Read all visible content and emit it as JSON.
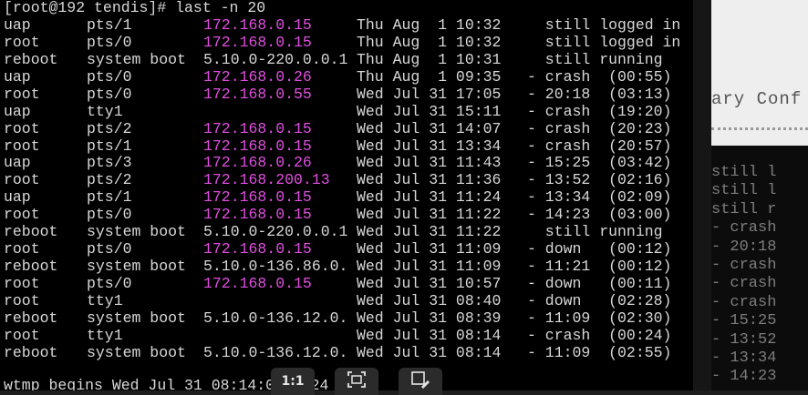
{
  "prompt": "[root@192 tendis]# last -n 20",
  "rows": [
    {
      "user": "uap",
      "tty": "pts/1",
      "host": "172.168.0.15",
      "host_is_ip": true,
      "date": "Thu Aug  1 10:32",
      "status": "  still logged in"
    },
    {
      "user": "root",
      "tty": "pts/0",
      "host": "172.168.0.15",
      "host_is_ip": true,
      "date": "Thu Aug  1 10:32",
      "status": "  still logged in"
    },
    {
      "user": "reboot",
      "tty": "system boot",
      "host": "5.10.0-220.0.0.1",
      "host_is_ip": false,
      "date": "Thu Aug  1 10:31",
      "status": "  still running"
    },
    {
      "user": "uap",
      "tty": "pts/0",
      "host": "172.168.0.26",
      "host_is_ip": true,
      "date": "Thu Aug  1 09:35",
      "status": "- crash  (00:55)"
    },
    {
      "user": "root",
      "tty": "pts/0",
      "host": "172.168.0.55",
      "host_is_ip": true,
      "date": "Wed Jul 31 17:05",
      "status": "- 20:18  (03:13)"
    },
    {
      "user": "uap",
      "tty": "tty1",
      "host": "",
      "host_is_ip": false,
      "date": "Wed Jul 31 15:11",
      "status": "- crash  (19:20)"
    },
    {
      "user": "root",
      "tty": "pts/2",
      "host": "172.168.0.15",
      "host_is_ip": true,
      "date": "Wed Jul 31 14:07",
      "status": "- crash  (20:23)"
    },
    {
      "user": "root",
      "tty": "pts/1",
      "host": "172.168.0.15",
      "host_is_ip": true,
      "date": "Wed Jul 31 13:34",
      "status": "- crash  (20:57)"
    },
    {
      "user": "uap",
      "tty": "pts/3",
      "host": "172.168.0.26",
      "host_is_ip": true,
      "date": "Wed Jul 31 11:43",
      "status": "- 15:25  (03:42)"
    },
    {
      "user": "root",
      "tty": "pts/2",
      "host": "172.168.200.13",
      "host_is_ip": true,
      "date": "Wed Jul 31 11:36",
      "status": "- 13:52  (02:16)"
    },
    {
      "user": "uap",
      "tty": "pts/1",
      "host": "172.168.0.15",
      "host_is_ip": true,
      "date": "Wed Jul 31 11:24",
      "status": "- 13:34  (02:09)"
    },
    {
      "user": "root",
      "tty": "pts/0",
      "host": "172.168.0.15",
      "host_is_ip": true,
      "date": "Wed Jul 31 11:22",
      "status": "- 14:23  (03:00)"
    },
    {
      "user": "reboot",
      "tty": "system boot",
      "host": "5.10.0-220.0.0.1",
      "host_is_ip": false,
      "date": "Wed Jul 31 11:22",
      "status": "  still running"
    },
    {
      "user": "root",
      "tty": "pts/0",
      "host": "172.168.0.15",
      "host_is_ip": true,
      "date": "Wed Jul 31 11:09",
      "status": "- down   (00:12)"
    },
    {
      "user": "reboot",
      "tty": "system boot",
      "host": "5.10.0-136.86.0.",
      "host_is_ip": false,
      "date": "Wed Jul 31 11:09",
      "status": "- 11:21  (00:12)"
    },
    {
      "user": "root",
      "tty": "pts/0",
      "host": "172.168.0.15",
      "host_is_ip": true,
      "date": "Wed Jul 31 10:57",
      "status": "- down   (00:11)"
    },
    {
      "user": "root",
      "tty": "tty1",
      "host": "",
      "host_is_ip": false,
      "date": "Wed Jul 31 08:40",
      "status": "- down   (02:28)"
    },
    {
      "user": "reboot",
      "tty": "system boot",
      "host": "5.10.0-136.12.0.",
      "host_is_ip": false,
      "date": "Wed Jul 31 08:39",
      "status": "- 11:09  (02:30)"
    },
    {
      "user": "root",
      "tty": "tty1",
      "host": "",
      "host_is_ip": false,
      "date": "Wed Jul 31 08:14",
      "status": "- crash  (00:24)"
    },
    {
      "user": "reboot",
      "tty": "system boot",
      "host": "5.10.0-136.12.0.",
      "host_is_ip": false,
      "date": "Wed Jul 31 08:14",
      "status": "- 11:09  (02:55)"
    }
  ],
  "footer": "wtmp begins Wed Jul 31 08:14:09 2024",
  "background_window": {
    "title_fragment": "ary Conf",
    "lines": [
      "still l",
      "still l",
      "still r",
      "- crash",
      "- 20:18",
      "- crash",
      "- crash",
      "- crash",
      "- 15:25",
      "- 13:52",
      "- 13:34",
      "- 14:23"
    ]
  },
  "overlay": {
    "ratio_label": "1:1",
    "fit_icon": "fit-to-screen-icon",
    "edit_icon": "image-edit-icon"
  },
  "colors": {
    "ip": "#e14ee1",
    "text": "#d8d8d8",
    "background": "#000000"
  }
}
